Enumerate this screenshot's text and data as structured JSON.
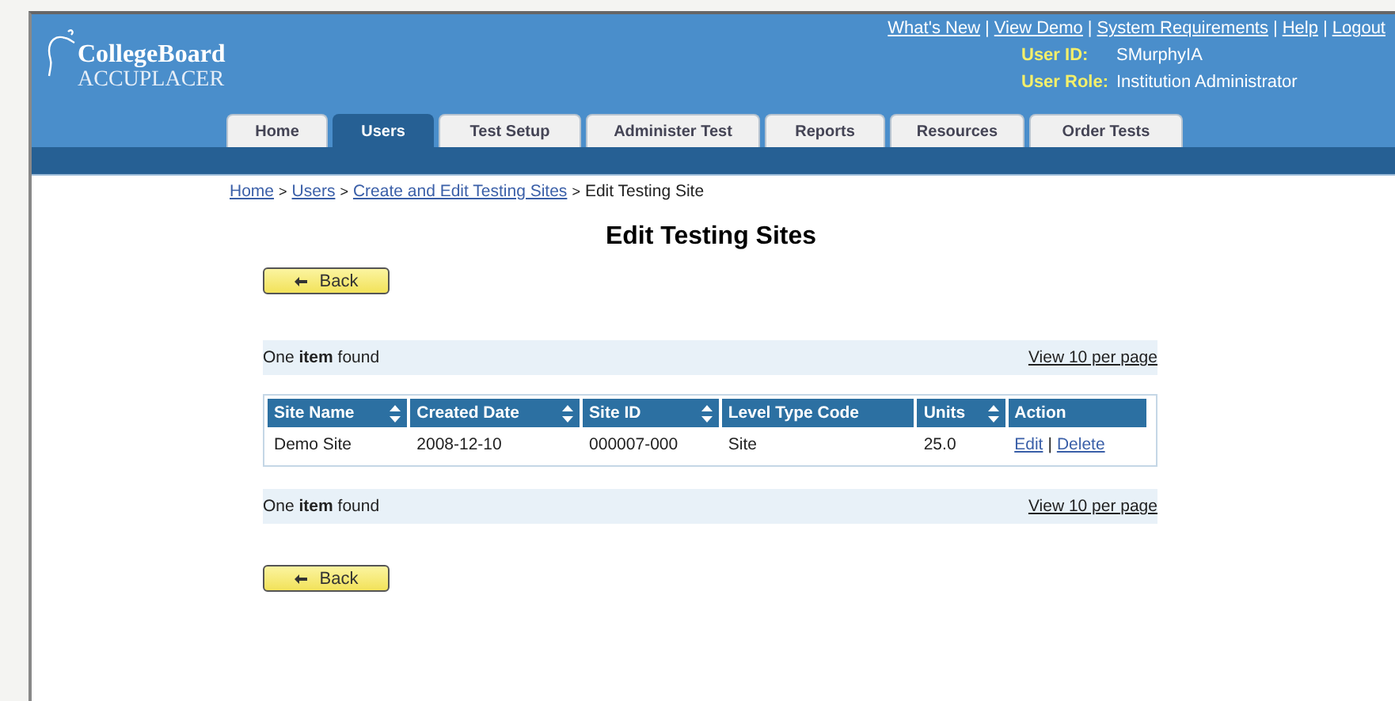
{
  "logo": {
    "brand": "CollegeBoard",
    "product": "ACCUPLACER"
  },
  "top_links": [
    {
      "kind": "link",
      "text": "What's New"
    },
    {
      "kind": "separator",
      "text": "|"
    },
    {
      "kind": "link",
      "text": "View Demo"
    },
    {
      "kind": "separator",
      "text": "|"
    },
    {
      "kind": "link",
      "text": "System Requirements"
    },
    {
      "kind": "separator",
      "text": "|"
    },
    {
      "kind": "link",
      "text": "Help"
    },
    {
      "kind": "separator",
      "text": "|"
    },
    {
      "kind": "link",
      "text": "Logout"
    }
  ],
  "user_info": [
    {
      "label": "User ID:",
      "value": "SMurphyIA"
    },
    {
      "label": "User Role:",
      "value": "Institution Administrator"
    }
  ],
  "tabs": [
    {
      "label": "Home",
      "selected": false
    },
    {
      "label": "Users",
      "selected": true
    },
    {
      "label": "Test Setup",
      "selected": false
    },
    {
      "label": "Administer Test",
      "selected": false
    },
    {
      "label": "Reports",
      "selected": false
    },
    {
      "label": "Resources",
      "selected": false
    },
    {
      "label": "Order Tests",
      "selected": false
    }
  ],
  "breadcrumb": [
    {
      "kind": "link",
      "text": "Home"
    },
    {
      "kind": "separator",
      "text": ">"
    },
    {
      "kind": "link",
      "text": "Users"
    },
    {
      "kind": "separator",
      "text": ">"
    },
    {
      "kind": "link",
      "text": "Create and Edit Testing Sites"
    },
    {
      "kind": "separator",
      "text": ">"
    },
    {
      "kind": "current",
      "text": "Edit Testing Site"
    }
  ],
  "title": "Edit Testing Sites",
  "back_buttons": [
    "Back",
    "Back"
  ],
  "result_bars": [
    {
      "count": "One **item** found",
      "link": "View 10 per page"
    },
    {
      "count": "One **item** found",
      "link": "View 10 per page"
    }
  ],
  "table": {
    "columns": [
      {
        "label": "Site Name",
        "sortable": true
      },
      {
        "label": "Created Date",
        "sortable": true
      },
      {
        "label": "Site ID",
        "sortable": true
      },
      {
        "label": "Level Type Code",
        "sortable": false
      },
      {
        "label": "Units",
        "sortable": true
      },
      {
        "label": "Action",
        "sortable": false
      }
    ],
    "rows": [
      {
        "cells": [
          "Demo Site",
          "2008-12-10",
          "000007-000",
          "Site",
          "25.0"
        ],
        "actions": [
          {
            "kind": "link",
            "text": "Edit"
          },
          {
            "kind": "separator",
            "text": "|"
          },
          {
            "kind": "link",
            "text": "Delete"
          }
        ]
      }
    ]
  }
}
